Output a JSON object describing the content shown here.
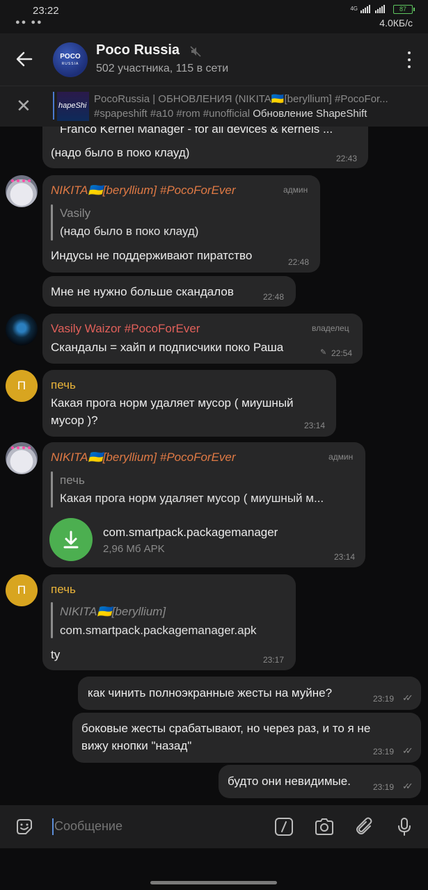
{
  "status_bar": {
    "time": "23:22",
    "notif_icons": "●● ●●",
    "network_type": "4G",
    "battery": "87",
    "speed": "4.0КБ/с"
  },
  "header": {
    "title": "Poco Russia",
    "subtitle": "502 участника, 115 в сети",
    "avatar_text_1": "POCO",
    "avatar_text_2": "RUSSIA"
  },
  "pinned": {
    "line1": "PocoRussia | ОБНОВЛЕНИЯ (NIKITA🇺🇦[beryllium] #PocoFor...",
    "tags": "#spapeshift #a10 #rom #unofficial ",
    "preview": "Обновление ShapeShift",
    "thumb_text": "hapeShi"
  },
  "messages": [
    {
      "text_top": "Franco Kernel Manager - for all devices & kernels ...",
      "text": "(надо было в поко клауд)",
      "time": "22:43"
    },
    {
      "sender": "NIKITA🇺🇦[beryllium] #PocoForEver",
      "role": "админ",
      "quote_name": "Vasily",
      "quote_text": "(надо было в поко клауд)",
      "text": "Индусы не поддерживают пиратство",
      "time": "22:48"
    },
    {
      "text": "Мне не нужно больше скандалов",
      "time": "22:48"
    },
    {
      "sender": "Vasily Waizor #PocoForEver",
      "role": "владелец",
      "text": "Скандалы = хайп и подписчики поко Раша",
      "time": "22:54"
    },
    {
      "sender": "печь",
      "avatar_letter": "П",
      "text1": "Какая прога норм удаляет мусор ( миушный",
      "text2": "мусор )?",
      "time": "23:14"
    },
    {
      "sender": "NIKITA🇺🇦[beryllium] #PocoForEver",
      "role": "админ",
      "quote_name": "печь",
      "quote_text": "Какая прога норм удаляет мусор ( миушный м...",
      "file_name": "com.smartpack.packagemanager",
      "file_size": "2,96 Мб APK",
      "time": "23:14"
    },
    {
      "sender": "печь",
      "avatar_letter": "П",
      "quote_name": "NIKITA🇺🇦[beryllium]",
      "quote_text": "com.smartpack.packagemanager.apk",
      "text": "ty",
      "time": "23:17"
    },
    {
      "text": "как чинить полноэкранные жесты на муйне?",
      "time": "23:19"
    },
    {
      "text1": "боковые жесты срабатывают, но через раз, и то я не",
      "text2": "вижу кнопки \"назад\"",
      "time": "23:19"
    },
    {
      "text": "будто они невидимые.",
      "time": "23:19"
    }
  ],
  "input": {
    "placeholder": "Сообщение"
  },
  "colors": {
    "orange_sender": "#e07a45",
    "red_sender": "#e0605a",
    "yellow_sender": "#e8b33a",
    "accent": "#5b8dd8",
    "file_green": "#4caf50"
  }
}
